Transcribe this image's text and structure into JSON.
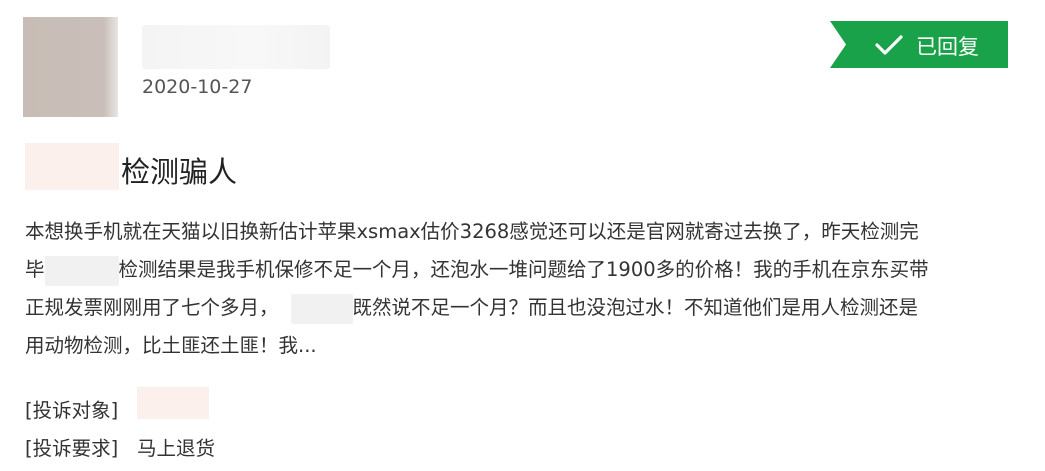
{
  "post": {
    "date": "2020-10-27",
    "status_badge": "已回复",
    "title": "检测骗人",
    "body_lines": [
      "本想换手机就在天猫以旧换新估计苹果xsmax估价3268感觉还可以还是官网就寄过去换了，昨天检测完",
      "检测结果是我手机保修不足一个月，还泡水一堆问题给了1900多的价格！我的手机在京东买带",
      "正规发票刚刚用了七个多月，",
      "既然说不足一个月？而且也没泡过水！不知道他们是用人检测还是",
      "用动物检测，比土匪还土匪！我..."
    ],
    "line2_prefix": "毕",
    "target_label": "[投诉对象]",
    "request_label": "[投诉要求]",
    "request_value": "马上退货"
  },
  "colors": {
    "badge": "#1aa24a",
    "text": "#333333"
  },
  "icons": {
    "badge_icon": "check-icon"
  }
}
